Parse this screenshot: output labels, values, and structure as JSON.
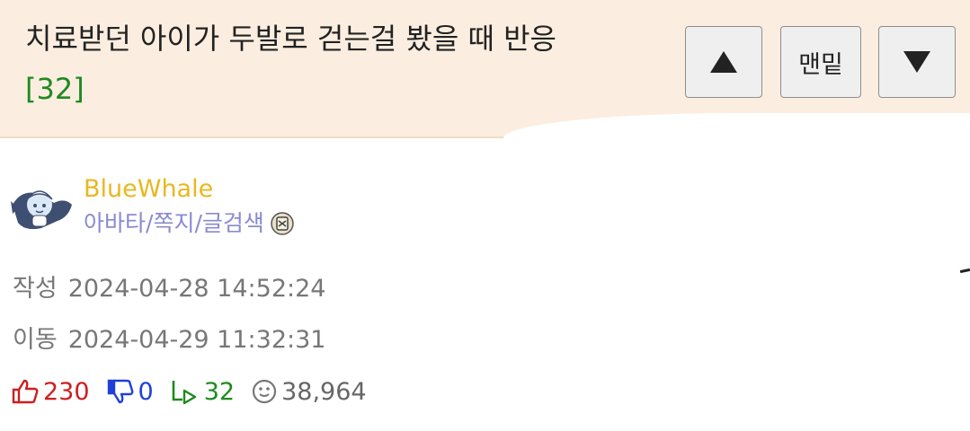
{
  "post": {
    "title": "치료받던 아이가 두발로 걷는걸 봤을 때 반응",
    "comment_count": "[32]"
  },
  "nav": {
    "up_icon": "triangle-up-icon",
    "bottom_label": "맨밑",
    "down_icon": "triangle-down-icon"
  },
  "author": {
    "name": "BlueWhale",
    "links": [
      "아바타",
      "쪽지",
      "글검색"
    ],
    "separator": "/",
    "avatar_icon": "whale-costume-avatar",
    "level_icon": "level-badge-icon"
  },
  "meta": {
    "written_label": "작성",
    "written_value": "2024-04-28 14:52:24",
    "moved_label": "이동",
    "moved_value": "2024-04-29 11:32:31"
  },
  "stats": {
    "upvotes": "230",
    "downvotes": "0",
    "replies": "32",
    "views": "38,964"
  },
  "colors": {
    "header_bg": "#fbeee0",
    "username": "#e8b820",
    "links": "#8a8ad0",
    "upvote": "#cc1f1f",
    "downvote": "#2040d8",
    "reply": "#1f8a1f"
  }
}
